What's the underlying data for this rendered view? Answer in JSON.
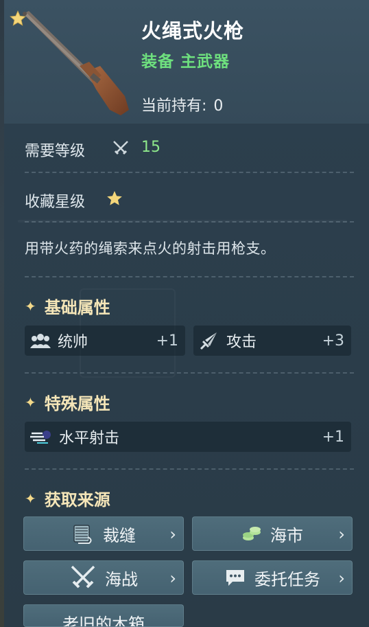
{
  "item": {
    "name": "火绳式火枪",
    "category": "装备 主武器",
    "owned_label": "当前持有:",
    "owned_value": "0",
    "icon": "musket-icon"
  },
  "requirements": {
    "level_label": "需要等级",
    "level_icon": "crossed-swords-icon",
    "level_value": "15",
    "collect_label": "收藏星级",
    "collect_icon": "star-icon"
  },
  "description": "用带火药的绳索来点火的射击用枪支。",
  "basic_attrs": {
    "title": "基础属性",
    "items": [
      {
        "label": "统帅",
        "value": "+1",
        "icon": "people-icon"
      },
      {
        "label": "攻击",
        "value": "+3",
        "icon": "sword-icon"
      }
    ]
  },
  "special_attrs": {
    "title": "特殊属性",
    "items": [
      {
        "label": "水平射击",
        "value": "+1",
        "icon": "horizontal-shot-icon"
      }
    ]
  },
  "sources": {
    "title": "获取来源",
    "items": [
      {
        "label": "裁缝",
        "icon": "fabric-roll-icon"
      },
      {
        "label": "海市",
        "icon": "coins-icon"
      },
      {
        "label": "海战",
        "icon": "crossed-swords-icon"
      },
      {
        "label": "委托任务",
        "icon": "chat-icon"
      },
      {
        "label": "老旧的木箱",
        "icon": ""
      }
    ]
  },
  "colors": {
    "accent_green": "#6ee07e",
    "level_green": "#8ee88b",
    "gold": "#f3d98a"
  }
}
